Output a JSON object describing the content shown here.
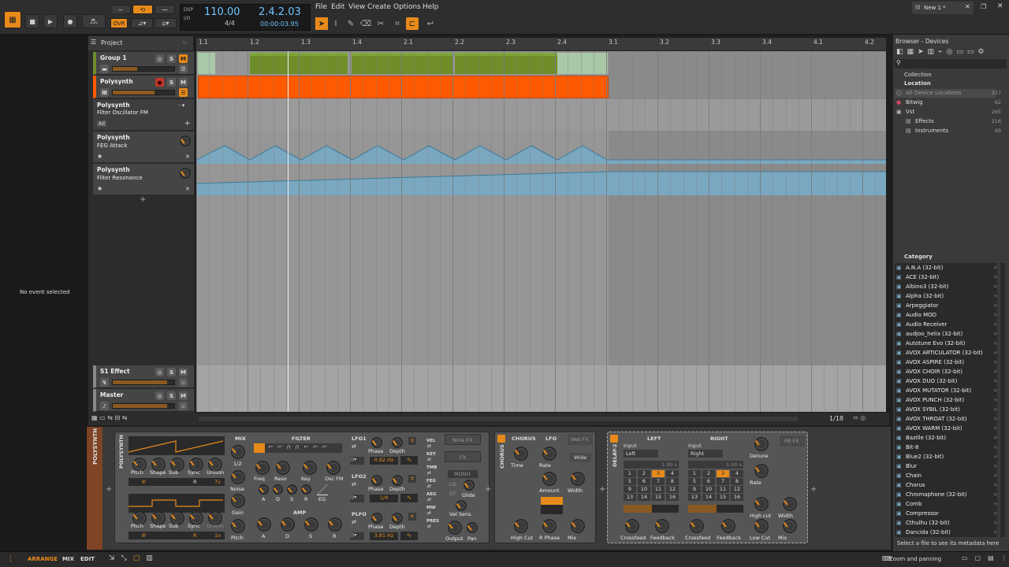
{
  "transport": {
    "tempo": "110.00",
    "position": "2.4.2.03",
    "signature": "4/4",
    "time": "00:00:03.95",
    "dsp": "DSP",
    "io": "I/O",
    "ovr": "OVR"
  },
  "menu": [
    "File",
    "Edit",
    "View",
    "Create",
    "Options",
    "Help"
  ],
  "tab": {
    "label": "New 1 *"
  },
  "arranger": {
    "project_label": "Project"
  },
  "ruler": [
    "1.1",
    "1.2",
    "1.3",
    "1.4",
    "2.1",
    "2.2",
    "2.3",
    "2.4",
    "3.1",
    "3.2",
    "3.3",
    "3.4",
    "4.1",
    "4.2"
  ],
  "tracks": [
    {
      "name": "Group 1"
    },
    {
      "name": "Polysynth"
    },
    {
      "name": "Polysynth",
      "sub": "Filter Oscillator FM"
    },
    {
      "name": "Polysynth",
      "sub": "FEG Attack"
    },
    {
      "name": "Polysynth",
      "sub": "Filter Resonance"
    }
  ],
  "all_label": "All",
  "effect_track": "S1 Effect",
  "master_track": "Master",
  "inspector": {
    "empty": "No event selected"
  },
  "zoom": "1/18",
  "browser": {
    "title": "Browser - Devices",
    "collection": "Collection",
    "location": "Location",
    "locations": [
      {
        "name": "All Device Locations",
        "count": "327"
      },
      {
        "name": "Bitwig",
        "count": "62"
      },
      {
        "name": "Vst",
        "count": "265"
      },
      {
        "name": "Effects",
        "count": "216"
      },
      {
        "name": "Instruments",
        "count": "49"
      }
    ],
    "category": "Category",
    "items": [
      "A.N.A (32-bit)",
      "ACE (32-bit)",
      "Albino3 (32-bit)",
      "Alpha (32-bit)",
      "Arpeggiator",
      "Audio MOD",
      "Audio Receiver",
      "audjoo_helix (32-bit)",
      "Autotune Evo (32-bit)",
      "AVOX ARTICULATOR (32-bit)",
      "AVOX ASPIRE (32-bit)",
      "AVOX CHOIR (32-bit)",
      "AVOX DUO (32-bit)",
      "AVOX MUTATOR (32-bit)",
      "AVOX PUNCH (32-bit)",
      "AVOX SYBIL (32-bit)",
      "AVOX THROAT (32-bit)",
      "AVOX WARM (32-bit)",
      "Bazille (32-bit)",
      "Bit-8",
      "Blue2 (32-bit)",
      "Blur",
      "Chain",
      "Chorus",
      "Chromaphone (32-bit)",
      "Comb",
      "Compressor",
      "Cthulhu (32-bit)",
      "Dancida (32-bit)"
    ],
    "footer": "Select a file to see its metadata here"
  },
  "device": {
    "polysynth": "POLYSYNTH",
    "polysynth2": "POLYSYNTH",
    "mix": "MIX",
    "filter": "FILTER",
    "amp": "AMP",
    "osc1": [
      "Pitch",
      "Shape",
      "Sub",
      "Sync",
      "Unison"
    ],
    "osc2": [
      "Pitch",
      "Shape",
      "Sub",
      "Sync",
      "Unison"
    ],
    "osc1_vals": [
      "8'",
      "R",
      "7v"
    ],
    "osc2_vals": [
      "8'",
      "R",
      "1v"
    ],
    "mix_labels": [
      "1/2",
      "Noise",
      "Gain",
      "Pitch"
    ],
    "filter_labels": [
      "Freq",
      "Reso",
      "Key",
      "Osc FM"
    ],
    "feg": [
      "A",
      "D",
      "S",
      "R",
      "EG"
    ],
    "amp_labels": [
      "A",
      "D",
      "S",
      "R"
    ],
    "lfo1": "LFO1",
    "lfo2": "LFO2",
    "plfo": "PLFO",
    "lfo_labels": [
      "Phase",
      "Depth"
    ],
    "lfo1_rate": "0.92 Hz",
    "lfo2_rate": "1/4",
    "plfo_rate": "3.81 Hz",
    "mod_labels": [
      "VEL",
      "KEY",
      "TMB",
      "FEG",
      "AEG",
      "MW",
      "PRES"
    ],
    "notefx": "Note FX",
    "fx": "FX",
    "mono": "MONO",
    "lg": "LG",
    "st": "ST",
    "glide": "Glide",
    "velsens": "Vel Sens.",
    "output": "Output",
    "pan": "Pan"
  },
  "chorus": {
    "title": "CHORUS",
    "lfo": "LFO",
    "wetfx": "Wet FX",
    "wide": "Wide",
    "labels": [
      "Time",
      "Rate",
      "Amount",
      "Width",
      "High Cut",
      "R Phase",
      "Mix"
    ],
    "side": "CHORUS"
  },
  "delay": {
    "title": "DELAY-2",
    "left": "LEFT",
    "right": "RIGHT",
    "input": "Input",
    "left_sel": "Left",
    "right_sel": "Right",
    "time": "1.00 s",
    "grid": [
      "1",
      "2",
      "3",
      "4",
      "5",
      "6",
      "7",
      "8",
      "9",
      "10",
      "11",
      "12",
      "13",
      "14",
      "15",
      "16"
    ],
    "labels": [
      "Detune",
      "Rate",
      "High cut",
      "Width",
      "Crossfeed",
      "Feedback",
      "Crossfeed",
      "Feedback",
      "Low Cut",
      "Mix"
    ],
    "fbfx": "FB FX"
  },
  "bottom": {
    "arrange": "ARRANGE",
    "mix": "MIX",
    "edit": "EDIT",
    "zoom": "Zoom and panning"
  },
  "colors": {
    "accent": "#e88a1a",
    "clip_green": "#6f8e2a",
    "clip_orange": "#ff5a00",
    "automation": "#7aa8c0"
  }
}
